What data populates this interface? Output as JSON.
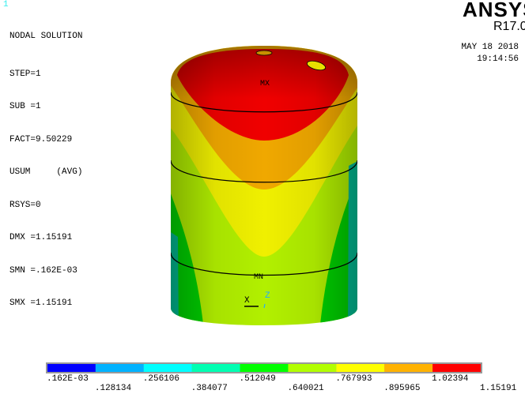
{
  "window_number": "1",
  "title": "NODAL SOLUTION",
  "info": [
    "STEP=1",
    "SUB =1",
    "FACT=9.50229",
    "USUM     (AVG)",
    "RSYS=0",
    "DMX =1.15191",
    "SMN =.162E-03",
    "SMX =1.15191"
  ],
  "brand": "ANSYS",
  "release": "R17.0",
  "date": "MAY 18 2018",
  "time": "19:14:56",
  "labels": {
    "max": "MX",
    "min": "MN",
    "axis_x": "X",
    "axis_z": "Z"
  },
  "legend": {
    "colors": [
      "#0000ff",
      "#00b2ff",
      "#00ffff",
      "#00ffb2",
      "#00ff00",
      "#b2ff00",
      "#ffff00",
      "#ffb200",
      "#ff0000"
    ],
    "ticks": [
      ".162E-03",
      ".128134",
      ".256106",
      ".384077",
      ".512049",
      ".640021",
      ".767993",
      ".895965",
      "1.02394",
      "1.15191"
    ]
  }
}
